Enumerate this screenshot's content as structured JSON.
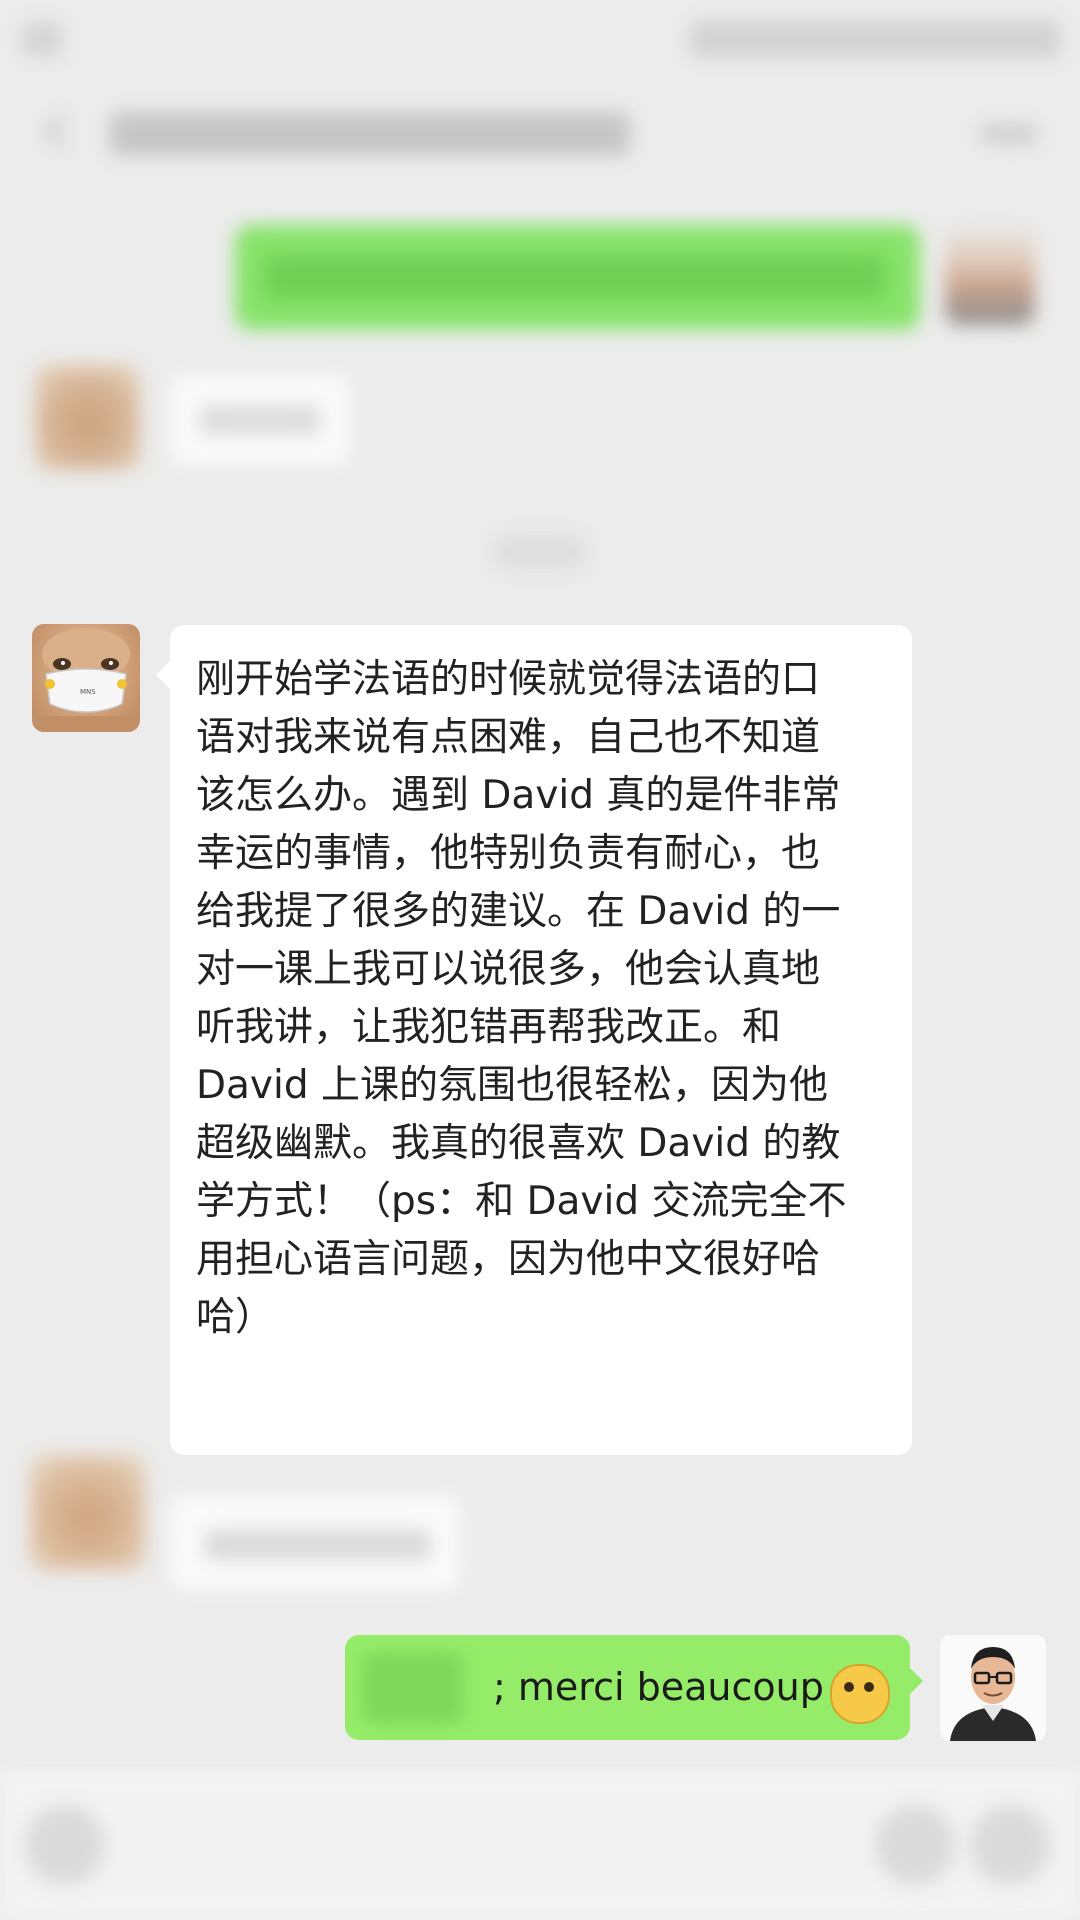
{
  "chat": {
    "main_message": "刚开始学法语的时候就觉得法语的口\n语对我来说有点困难，自己也不知道\n该怎么办。遇到 David 真的是件非常\n幸运的事情，他特别负责有耐心，也\n给我提了很多的建议。在 David 的一\n对一课上我可以说很多，他会认真地\n听我讲，让我犯错再帮我改正。和\nDavid 上课的氛围也很轻松，因为他\n超级幽默。我真的很喜欢 David 的教\n学方式！（ps：和 David 交流完全不\n用担心语言问题，因为他中文很好哈\n哈）",
    "last_message": "; merci beaucoup",
    "last_message_emoji": "thinking-face-emoji",
    "mask_label": "MNS"
  },
  "colors": {
    "background": "#ececec",
    "incoming_bubble": "#ffffff",
    "outgoing_bubble": "#95ec69"
  },
  "icons": {
    "back": "chevron-left-icon",
    "more": "more-icon",
    "voice": "voice-icon",
    "emoji": "emoji-icon",
    "plus": "plus-icon"
  }
}
